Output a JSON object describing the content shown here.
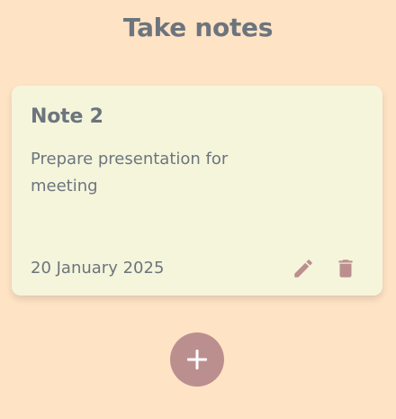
{
  "app": {
    "title": "Take notes"
  },
  "notes": [
    {
      "title": "Note 2",
      "body": "Prepare presentation for meeting",
      "date": "20 January 2025",
      "actions": {
        "edit_icon": "pencil-icon",
        "delete_icon": "trash-icon"
      }
    }
  ],
  "fab": {
    "icon": "plus-icon"
  },
  "colors": {
    "background": "#FFE3C5",
    "card": "#F5F5DC",
    "text": "#6C757D",
    "accent": "#BC8F8F"
  }
}
